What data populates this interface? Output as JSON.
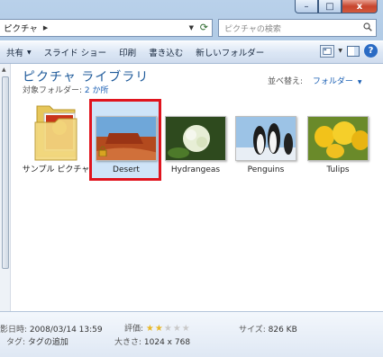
{
  "window": {
    "controls": {
      "minimize": "–",
      "maximize": "□",
      "close": "x"
    }
  },
  "address": {
    "path": "ピクチャ",
    "search_placeholder": "ピクチャの検索"
  },
  "toolbar": {
    "share_label": "共有",
    "slideshow_label": "スライド ショー",
    "print_label": "印刷",
    "burn_label": "書き込む",
    "new_folder_label": "新しいフォルダー",
    "help_label": "?"
  },
  "library": {
    "title": "ピクチャ ライブラリ",
    "target_label": "対象フォルダー:",
    "target_link": "2 か所",
    "arrange_label": "並べ替え:",
    "arrange_value": "フォルダー"
  },
  "items": [
    {
      "label": "サンプル ピクチャ",
      "type": "folder"
    },
    {
      "label": "Desert",
      "type": "photo",
      "selected": true
    },
    {
      "label": "Hydrangeas",
      "type": "photo"
    },
    {
      "label": "Penguins",
      "type": "photo"
    },
    {
      "label": "Tulips",
      "type": "photo"
    }
  ],
  "details": {
    "date_label": "影日時:",
    "date_value": "2008/03/14 13:59",
    "tags_label": "タグ:",
    "tags_value": "タグの追加",
    "rating_label": "評価:",
    "rating_value": 2,
    "rating_max": 5,
    "dims_label": "大きさ:",
    "dims_value": "1024 x 768",
    "size_label": "サイズ:",
    "size_value": "826 KB"
  },
  "colors": {
    "selection_border": "#e0141e",
    "link": "#1a5fb4",
    "title": "#1e5a9a"
  }
}
